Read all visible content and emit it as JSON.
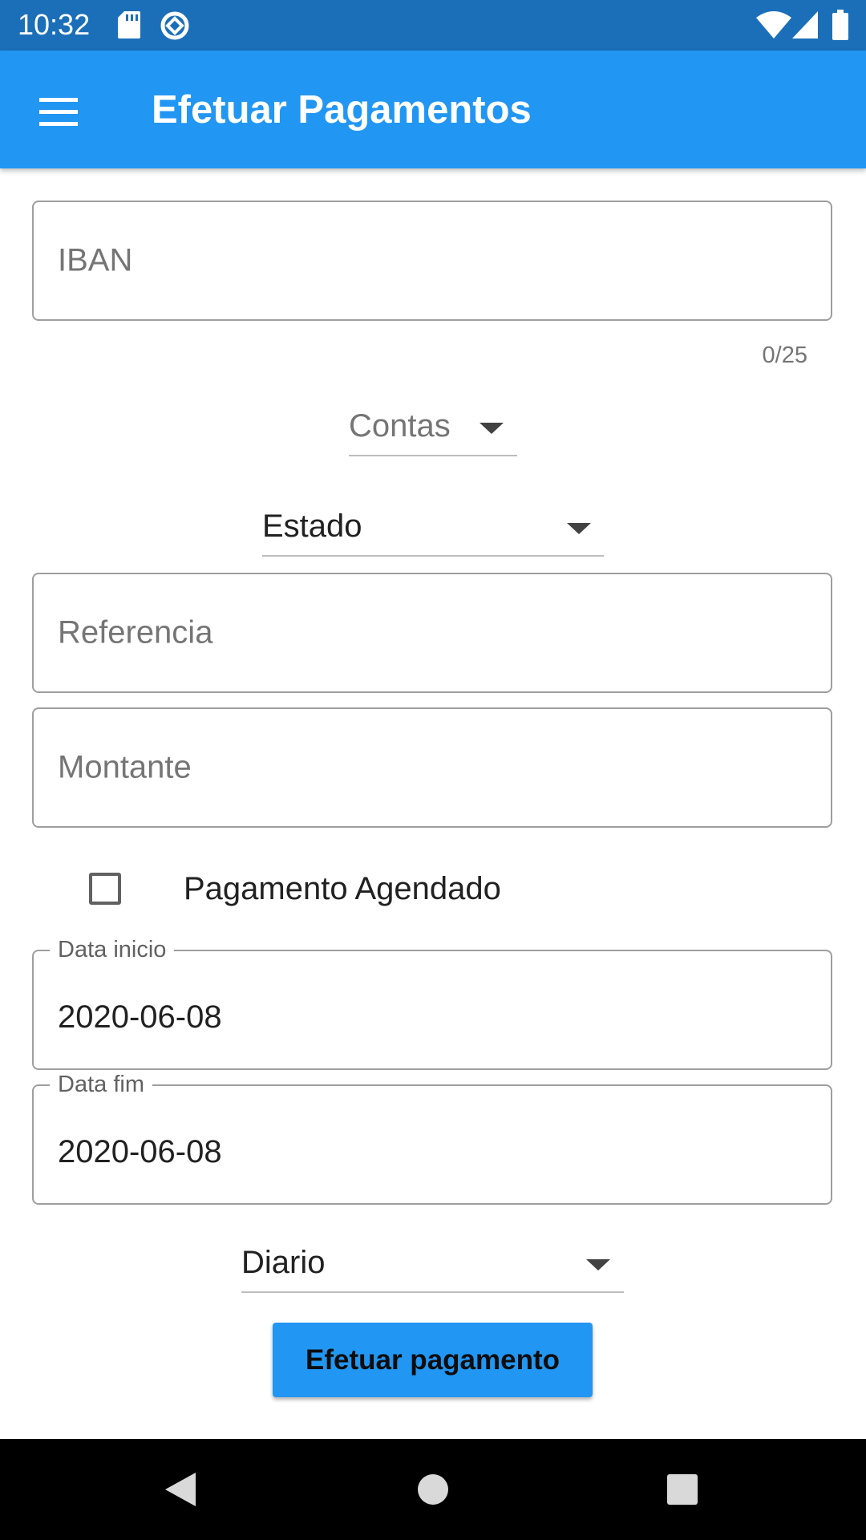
{
  "status_bar": {
    "time": "10:32",
    "icons": [
      "sd-card-icon",
      "data-saver-icon",
      "wifi-icon",
      "signal-icon",
      "battery-icon"
    ]
  },
  "app_bar": {
    "title": "Efetuar Pagamentos",
    "menu_icon": "menu-icon"
  },
  "form": {
    "iban": {
      "placeholder": "IBAN",
      "value": "",
      "counter": "0/25"
    },
    "contas": {
      "label": "Contas"
    },
    "estado": {
      "value": "Estado"
    },
    "referencia": {
      "placeholder": "Referencia",
      "value": ""
    },
    "montante": {
      "placeholder": "Montante",
      "value": ""
    },
    "scheduled": {
      "label": "Pagamento Agendado",
      "checked": false
    },
    "data_inicio": {
      "label": "Data inicio",
      "value": "2020-06-08"
    },
    "data_fim": {
      "label": "Data fim",
      "value": "2020-06-08"
    },
    "frequency": {
      "value": "Diario"
    },
    "submit_label": "Efetuar pagamento"
  },
  "colors": {
    "status_bar": "#1b6fb8",
    "app_bar": "#2196f3",
    "button": "#2196f3",
    "nav_bar": "#000000"
  },
  "nav_bar": {
    "icons": [
      "back-icon",
      "home-icon",
      "recents-icon"
    ]
  }
}
